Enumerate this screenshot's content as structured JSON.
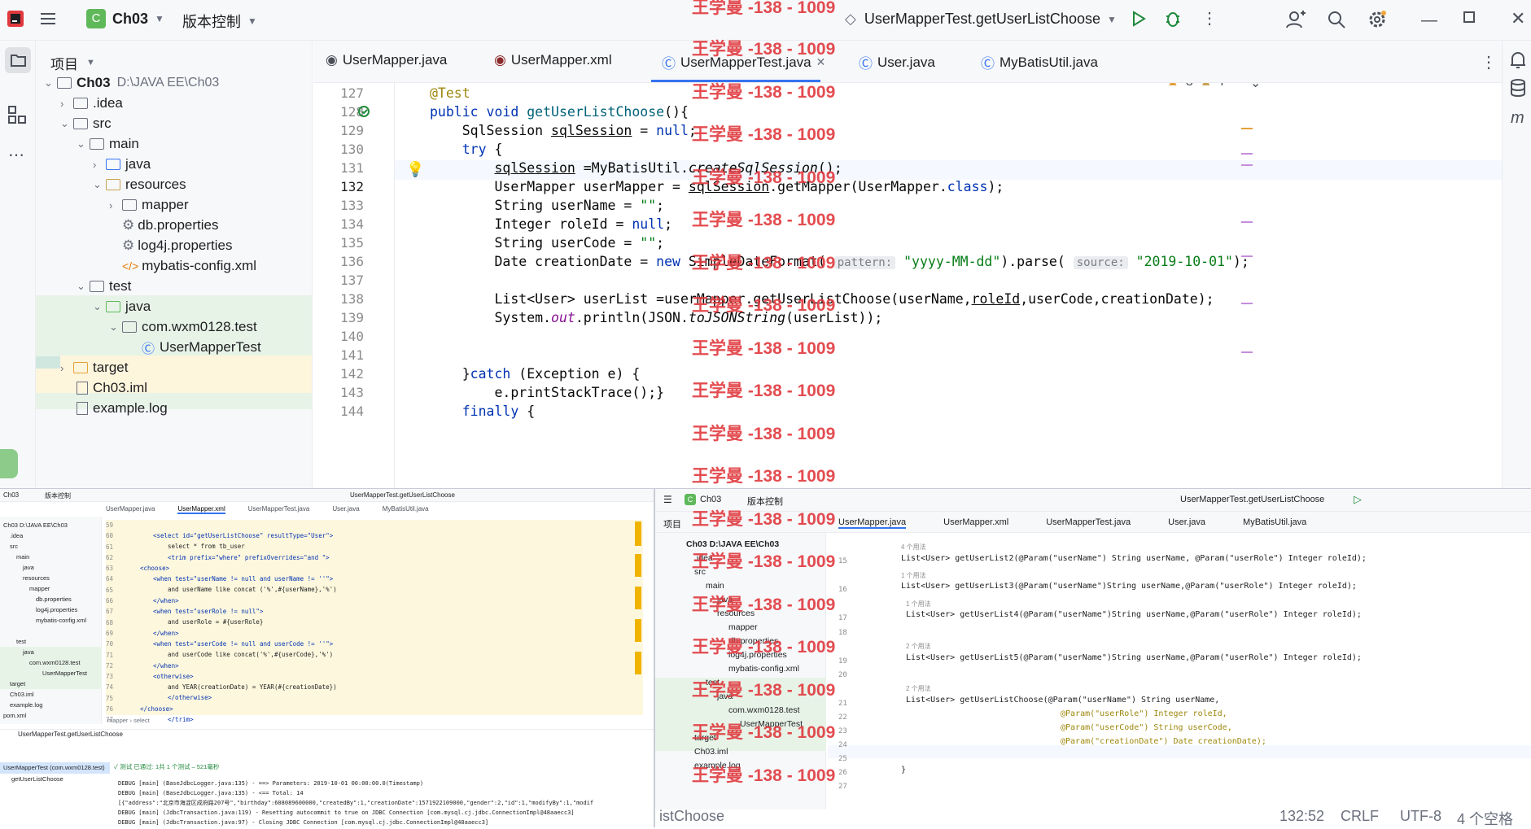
{
  "title_bar": {
    "project": "Ch03",
    "project_badge": "C",
    "vcs": "版本控制",
    "run_config": "UserMapperTest.getUserListChoose"
  },
  "watermark": "王学曼 -138 - 1009",
  "tabs": [
    {
      "label": "UserMapper.java"
    },
    {
      "label": "UserMapper.xml"
    },
    {
      "label": "UserMapperTest.java"
    },
    {
      "label": "User.java"
    },
    {
      "label": "MyBatisUtil.java"
    }
  ],
  "project_panel": {
    "title": "项目",
    "tree": [
      {
        "label": "Ch03",
        "path": "D:\\JAVA EE\\Ch03"
      },
      {
        "label": ".idea"
      },
      {
        "label": "src"
      },
      {
        "label": "main"
      },
      {
        "label": "java"
      },
      {
        "label": "resources"
      },
      {
        "label": "mapper"
      },
      {
        "label": "db.properties"
      },
      {
        "label": "log4j.properties"
      },
      {
        "label": "mybatis-config.xml"
      },
      {
        "label": "test"
      },
      {
        "label": "java"
      },
      {
        "label": "com.wxm0128.test"
      },
      {
        "label": "UserMapperTest"
      },
      {
        "label": "target"
      },
      {
        "label": "Ch03.iml"
      },
      {
        "label": "example.log"
      }
    ]
  },
  "inspections": {
    "warnings": "3",
    "weak_warnings": "7"
  },
  "editor": {
    "lines": [
      "127",
      "128",
      "129",
      "130",
      "131",
      "132",
      "133",
      "134",
      "135",
      "136",
      "137",
      "138",
      "139",
      "140",
      "141",
      "142",
      "143",
      "144"
    ],
    "hint_pattern": "pattern:",
    "hint_source": "source:"
  },
  "sub1": {
    "project": "Ch03",
    "vcs": "版本控制",
    "run": "UserMapperTest.getUserListChoose",
    "tabs": [
      "UserMapper.java",
      "UserMapper.xml",
      "UserMapperTest.java",
      "User.java",
      "MyBatisUtil.java"
    ],
    "tree": [
      "Ch03 D:\\JAVA EE\\Ch03",
      ".idea",
      "src",
      "main",
      "java",
      "resources",
      "mapper",
      "db.properties",
      "log4j.properties",
      "mybatis-config.xml",
      "test",
      "java",
      "com.wxm0128.test",
      "UserMapperTest",
      "target",
      "Ch03.iml",
      "example.log",
      "pom.xml"
    ],
    "lines": [
      "59",
      "60",
      "61",
      "62",
      "63",
      "64",
      "65",
      "66",
      "67",
      "68",
      "69",
      "70",
      "71",
      "72",
      "73",
      "74",
      "75",
      "76",
      "77"
    ],
    "code": [
      "<select id=\"getUserListChoose\" resultType=\"User\">",
      "select * from tb_user",
      "<trim prefix=\"where\" prefixOverrides=\"and \">",
      "<choose>",
      "<when test=\"userName != null and userName != ''\">",
      "and userName like concat ('%',#{userName},'%')",
      "</when>",
      "<when test=\"userRole != null\">",
      "and userRole = #{userRole}",
      "</when>",
      "<when test=\"userCode != null and userCode != ''\">",
      "and userCode like concat('%',#{userCode},'%')",
      "</when>",
      "<otherwise>",
      "and YEAR(creationDate) = YEAR(#{creationDate})",
      "</otherwise>",
      "</choose>",
      "</trim>"
    ],
    "breadcrumb": "mapper › select",
    "run_tab": "UserMapperTest.getUserListChoose",
    "tests": [
      "UserMapperTest (com.wxm0128.test)",
      "getUserListChoose"
    ],
    "status": "✓ 测试 已通过: 1共 1 个测试 – 521毫秒",
    "console": [
      "DEBUG [main] (BaseJdbcLogger.java:135) - ==> Parameters: 2019-10-01 00:00:00.0(Timestamp)",
      "DEBUG [main] (BaseJdbcLogger.java:135) - <==      Total: 14",
      "[{\"address\":\"北京市海淀区成府路207号\",\"birthday\":608089600000,\"createdBy\":1,\"creationDate\":1571922109000,\"gender\":2,\"id\":1,\"modifyBy\":1,\"modif",
      "DEBUG [main] (JdbcTransaction.java:119) - Resetting autocommit to true on JDBC Connection [com.mysql.cj.jdbc.ConnectionImpl@48aaecc3]",
      "DEBUG [main] (JdbcTransaction.java:97) - Closing JDBC Connection [com.mysql.cj.jdbc.ConnectionImpl@48aaecc3]"
    ]
  },
  "sub2": {
    "project": "Ch03",
    "vcs": "版本控制",
    "run": "UserMapperTest.getUserListChoose",
    "tabs": [
      "UserMapper.java",
      "UserMapper.xml",
      "UserMapperTest.java",
      "User.java",
      "MyBatisUtil.java"
    ],
    "panel_title": "项目",
    "tree": [
      "Ch03 D:\\JAVA EE\\Ch03",
      ".idea",
      "src",
      "main",
      "java",
      "resources",
      "mapper",
      "db.properties",
      "log4j.properties",
      "mybatis-config.xml",
      "test",
      "java",
      "com.wxm0128.test",
      "UserMapperTest",
      "target",
      "Ch03.iml",
      "example.log"
    ],
    "lines": [
      "15",
      "16",
      "17",
      "18",
      "19",
      "20",
      "21",
      "22",
      "23",
      "24",
      "25",
      "26",
      "27"
    ],
    "usages": [
      "4 个用法",
      "1 个用法",
      "1 个用法",
      "2 个用法",
      "2 个用法"
    ],
    "code": [
      "List<User> getUserList2(@Param(\"userName\") String userName, @Param(\"userRole\") Integer roleId);",
      "List<User> getUserList3(@Param(\"userName\")String userName,@Param(\"userRole\") Integer roleId);",
      "List<User> getUserList4(@Param(\"userName\")String userName,@Param(\"userRole\") Integer roleId);",
      "List<User> getUserList5(@Param(\"userName\")String userName,@Param(\"userRole\") Integer roleId);",
      "List<User> getUserListChoose(@Param(\"userName\") String userName,",
      "@Param(\"userRole\") Integer roleId,",
      "@Param(\"userCode\") String userCode,",
      "@Param(\"creationDate\") Date creationDate);",
      "}"
    ]
  },
  "status_bar": {
    "behind": "istChoose",
    "position": "132:52",
    "line_sep": "CRLF",
    "encoding": "UTF-8",
    "indent": "4 个空格"
  }
}
